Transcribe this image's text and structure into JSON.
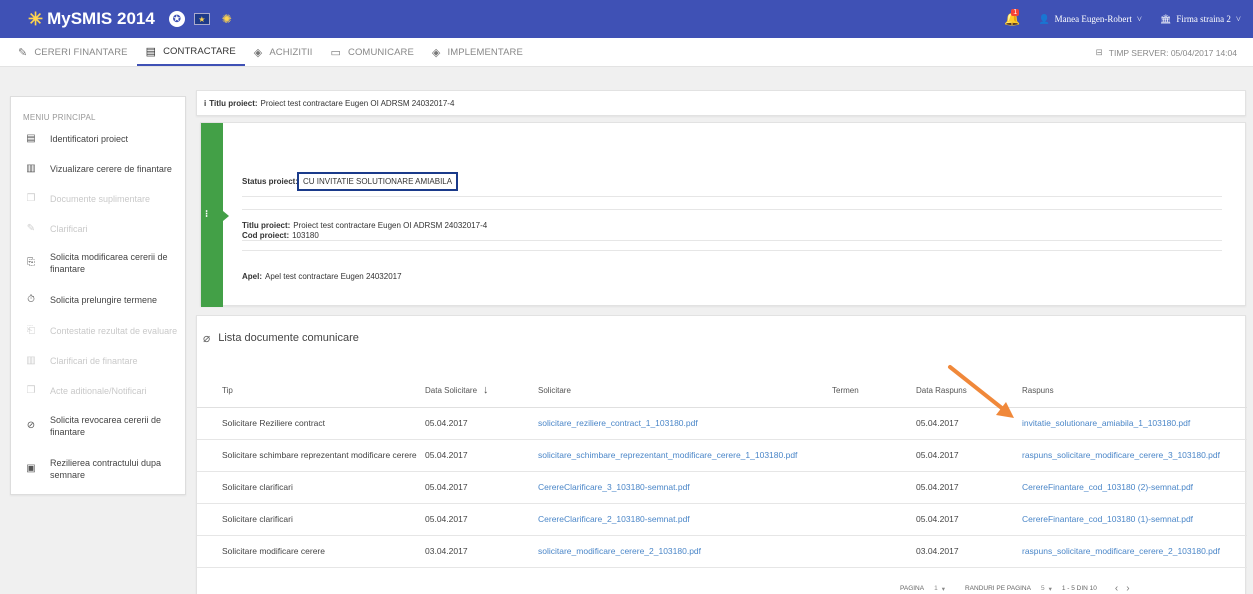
{
  "topbar": {
    "app_title": "MySMIS 2014",
    "notification_count": "1",
    "user_name": "Manea Eugen-Robert",
    "firm_name": "Firma straina 2",
    "accent_color": "#3f51b5"
  },
  "tabs": [
    {
      "label": "CERERI FINANTARE",
      "icon": "pencil-icon"
    },
    {
      "label": "CONTRACTARE",
      "icon": "document-icon",
      "active": true
    },
    {
      "label": "ACHIZITII",
      "icon": "layers-icon"
    },
    {
      "label": "COMUNICARE",
      "icon": "monitor-icon"
    },
    {
      "label": "IMPLEMENTARE",
      "icon": "layers-icon"
    }
  ],
  "server_time": "TIMP SERVER: 05/04/2017 14:04",
  "sidebar": {
    "title": "MENIU PRINCIPAL",
    "items": [
      {
        "label": "Identificatori proiect",
        "icon": "document-icon",
        "disabled": false
      },
      {
        "label": "Vizualizare cerere de finantare",
        "icon": "columns-icon",
        "disabled": false
      },
      {
        "label": "Documente suplimentare",
        "icon": "files-icon",
        "disabled": true
      },
      {
        "label": "Clarificari",
        "icon": "pencil-icon",
        "disabled": true
      },
      {
        "label": "Solicita modificarea cererii de finantare",
        "icon": "file-plus-icon",
        "disabled": false
      },
      {
        "label": "Solicita prelungire termene",
        "icon": "clock-icon",
        "disabled": false
      },
      {
        "label": "Contestatie rezultat de evaluare",
        "icon": "file-arrow-icon",
        "disabled": true
      },
      {
        "label": "Clarificari de finantare",
        "icon": "columns-icon",
        "disabled": true
      },
      {
        "label": "Acte aditionale/Notificari",
        "icon": "files-icon",
        "disabled": true
      },
      {
        "label": "Solicita revocarea cererii de finantare",
        "icon": "ban-icon",
        "disabled": false
      },
      {
        "label": "Rezilierea contractului dupa semnare",
        "icon": "contract-icon",
        "disabled": false
      }
    ]
  },
  "project": {
    "title_label": "Titlu proiect:",
    "title_value": "Proiect test contractare Eugen OI ADRSM 24032017-4",
    "status_label": "Status proiect:",
    "status_value": "CU INVITATIE SOLUTIONARE AMIABILA",
    "cod_label": "Cod proiect:",
    "cod_value": "103180",
    "apel_label": "Apel:",
    "apel_value": "Apel test contractare Eugen 24032017",
    "status_color": "#43a047"
  },
  "docs": {
    "header": "Lista documente comunicare",
    "columns": [
      "Tip",
      "Data Solicitare",
      "Solicitare",
      "Termen",
      "Data Raspuns",
      "Raspuns"
    ],
    "rows": [
      {
        "tip": "Solicitare Reziliere contract",
        "data": "05.04.2017",
        "solicitare": "solicitare_reziliere_contract_1_103180.pdf",
        "termen": "",
        "data_raspuns": "05.04.2017",
        "raspuns": "invitatie_solutionare_amiabila_1_103180.pdf"
      },
      {
        "tip": "Solicitare schimbare reprezentant modificare cerere",
        "data": "05.04.2017",
        "solicitare": "solicitare_schimbare_reprezentant_modificare_cerere_1_103180.pdf",
        "termen": "",
        "data_raspuns": "05.04.2017",
        "raspuns": "raspuns_solicitare_modificare_cerere_3_103180.pdf"
      },
      {
        "tip": "Solicitare clarificari",
        "data": "05.04.2017",
        "solicitare": "CerereClarificare_3_103180-semnat.pdf",
        "termen": "",
        "data_raspuns": "05.04.2017",
        "raspuns": "CerereFinantare_cod_103180 (2)-semnat.pdf"
      },
      {
        "tip": "Solicitare clarificari",
        "data": "05.04.2017",
        "solicitare": "CerereClarificare_2_103180-semnat.pdf",
        "termen": "",
        "data_raspuns": "05.04.2017",
        "raspuns": "CerereFinantare_cod_103180 (1)-semnat.pdf"
      },
      {
        "tip": "Solicitare modificare cerere",
        "data": "03.04.2017",
        "solicitare": "solicitare_modificare_cerere_2_103180.pdf",
        "termen": "",
        "data_raspuns": "03.04.2017",
        "raspuns": "raspuns_solicitare_modificare_cerere_2_103180.pdf"
      }
    ],
    "link_color": "#4a86c8"
  },
  "pagination": {
    "page_label": "PAGINA",
    "page_value": "1",
    "rows_label": "RANDURI PE PAGINA",
    "rows_value": "5",
    "range": "1 - 5 DIN 10"
  },
  "annotation": {
    "arrow_color": "#f0883a",
    "highlight_color": "#1a3a8a"
  }
}
